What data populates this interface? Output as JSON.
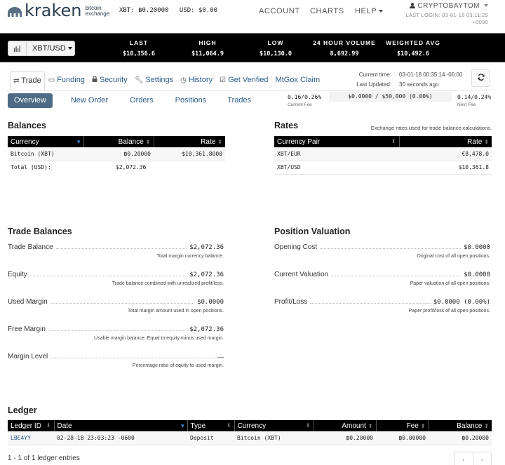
{
  "header": {
    "logo_word": "kraken",
    "logo_sub_1": "bitcoin",
    "logo_sub_2": "exchange",
    "wallet_xbt": "XBT: ฿0.20000",
    "wallet_usd": "USD: $0.00",
    "nav": {
      "account": "ACCOUNT",
      "charts": "CHARTS",
      "help": "HELP"
    },
    "username": "CRYPTOBAYTOM",
    "last_login_1": "LAST LOGIN: 03-01-18 03:11:29",
    "last_login_2": "+0000"
  },
  "ticker": {
    "pair": "XBT/USD",
    "stats": [
      {
        "label": "LAST",
        "value": "$10,356.6"
      },
      {
        "label": "HIGH",
        "value": "$11,064.9"
      },
      {
        "label": "LOW",
        "value": "$10,130.0"
      },
      {
        "label": "24 HOUR VOLUME",
        "value": "8,692.99"
      },
      {
        "label": "WEIGHTED AVG",
        "value": "$10,492.6"
      }
    ]
  },
  "tabs": [
    {
      "label": "Trade",
      "icon": "trade-icon"
    },
    {
      "label": "Funding",
      "icon": "funding-icon"
    },
    {
      "label": "Security",
      "icon": "lock-icon"
    },
    {
      "label": "Settings",
      "icon": "wrench-icon"
    },
    {
      "label": "History",
      "icon": "clock-icon"
    },
    {
      "label": "Get Verified",
      "icon": "checkbox-icon"
    },
    {
      "label": "MtGox Claim",
      "icon": ""
    }
  ],
  "time": {
    "current_label": "Current time:",
    "current_value": "03-01-18 00:35:14 -06:00",
    "updated_label": "Last Updated:",
    "updated_value": "30 seconds ago"
  },
  "subnav": [
    "Overview",
    "New Order",
    "Orders",
    "Positions",
    "Trades"
  ],
  "fees": {
    "current_value": "0.16/0.26%",
    "current_label": "Current Fee",
    "volume": "$0.0000 / $50,000 (0.00%)",
    "volume_fraction": 0.0,
    "next_value": "0.14/0.24%",
    "next_label": "Next Fee"
  },
  "balances": {
    "title": "Balances",
    "headers": [
      "Currency",
      "Balance",
      "Rate"
    ],
    "rows": [
      {
        "currency": "Bitcoin (XBT)",
        "balance": "฿0.20000",
        "rate": "$10,361.8000"
      }
    ],
    "total_label": "Total (USD):",
    "total_value": "$2,072.36"
  },
  "rates": {
    "title": "Rates",
    "note": "Exchange rates used for trade balance calculations.",
    "headers": [
      "Currency Pair",
      "Rate"
    ],
    "rows": [
      {
        "pair": "XBT/EUR",
        "rate": "€8,478.0"
      },
      {
        "pair": "XBT/USD",
        "rate": "$10,361.8"
      }
    ]
  },
  "trade_balances": {
    "title": "Trade Balances",
    "items": [
      {
        "label": "Trade Balance",
        "value": "$2,072.36",
        "desc": "Total margin currency balance."
      },
      {
        "label": "Equity",
        "value": "$2,072.36",
        "desc": "Trade balance combined with unrealized profit/loss."
      },
      {
        "label": "Used Margin",
        "value": "$0.0000",
        "desc": "Total margin amount used in open positions."
      },
      {
        "label": "Free Margin",
        "value": "$2,072.36",
        "desc": "Usable margin balance. Equal to equity minus used margin."
      },
      {
        "label": "Margin Level",
        "value": "—",
        "desc": "Percentage ratio of equity to used margin."
      }
    ]
  },
  "position_valuation": {
    "title": "Position Valuation",
    "items": [
      {
        "label": "Opening Cost",
        "value": "$0.0000",
        "desc": "Original cost of all open positions."
      },
      {
        "label": "Current Valuation",
        "value": "$0.0000",
        "desc": "Paper valuation of all open positions."
      },
      {
        "label": "Profit/Loss",
        "value": "$0.0000 (0.00%)",
        "desc": "Paper profit/loss of all open positions."
      }
    ]
  },
  "ledger": {
    "title": "Ledger",
    "headers": [
      "Ledger ID",
      "Date",
      "Type",
      "Currency",
      "Amount",
      "Fee",
      "Balance"
    ],
    "rows": [
      {
        "id": "LBE4YY",
        "date": "02-28-18 23:03:23 -0600",
        "type": "Deposit",
        "currency": "Bitcoin (XBT)",
        "amount": "฿0.20000",
        "fee": "฿0.00000",
        "balance": "฿0.20000"
      }
    ],
    "count": "1 - 1 of 1 ledger entries",
    "prev": "‹",
    "next": "›"
  }
}
